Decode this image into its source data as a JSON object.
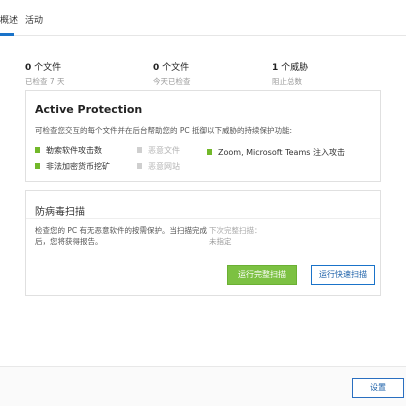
{
  "tabs": [
    {
      "label": "概述"
    },
    {
      "label": "活动"
    }
  ],
  "stats": [
    {
      "count": "0",
      "unit": "个文件",
      "sub": "已检查 7 天"
    },
    {
      "count": "0",
      "unit": "个文件",
      "sub": "今天已检查"
    },
    {
      "count": "1",
      "unit": "个威胁",
      "sub": "阻止总数"
    }
  ],
  "active_protection": {
    "title": "Active Protection",
    "description": "可检查您交互的每个文件并在后台帮助您的 PC 抵御以下威胁的持续保护功能:",
    "features": [
      {
        "label": "勒索软件攻击数",
        "enabled": true
      },
      {
        "label": "恶意文件",
        "enabled": false
      },
      {
        "label": "Zoom, Microsoft Teams 注入攻击",
        "enabled": true
      },
      {
        "label": "非法加密货币挖矿",
        "enabled": true
      },
      {
        "label": "恶意网站",
        "enabled": false
      }
    ]
  },
  "antivirus_scan": {
    "title": "防病毒扫描",
    "description": "检查您的 PC 有无恶意软件的按需保护。当扫描完成后，您将获得报告。",
    "next_scan_label": "下次完整扫描：",
    "next_scan_value": "未指定",
    "run_full_scan_label": "运行完整扫描",
    "run_quick_scan_label": "运行快速扫描"
  },
  "footer": {
    "settings_label": "设置"
  },
  "colors": {
    "accent_blue": "#1a73c9",
    "green": "#7cc142",
    "feature_on": "#72b82a",
    "feature_off": "#cfcfcf"
  }
}
